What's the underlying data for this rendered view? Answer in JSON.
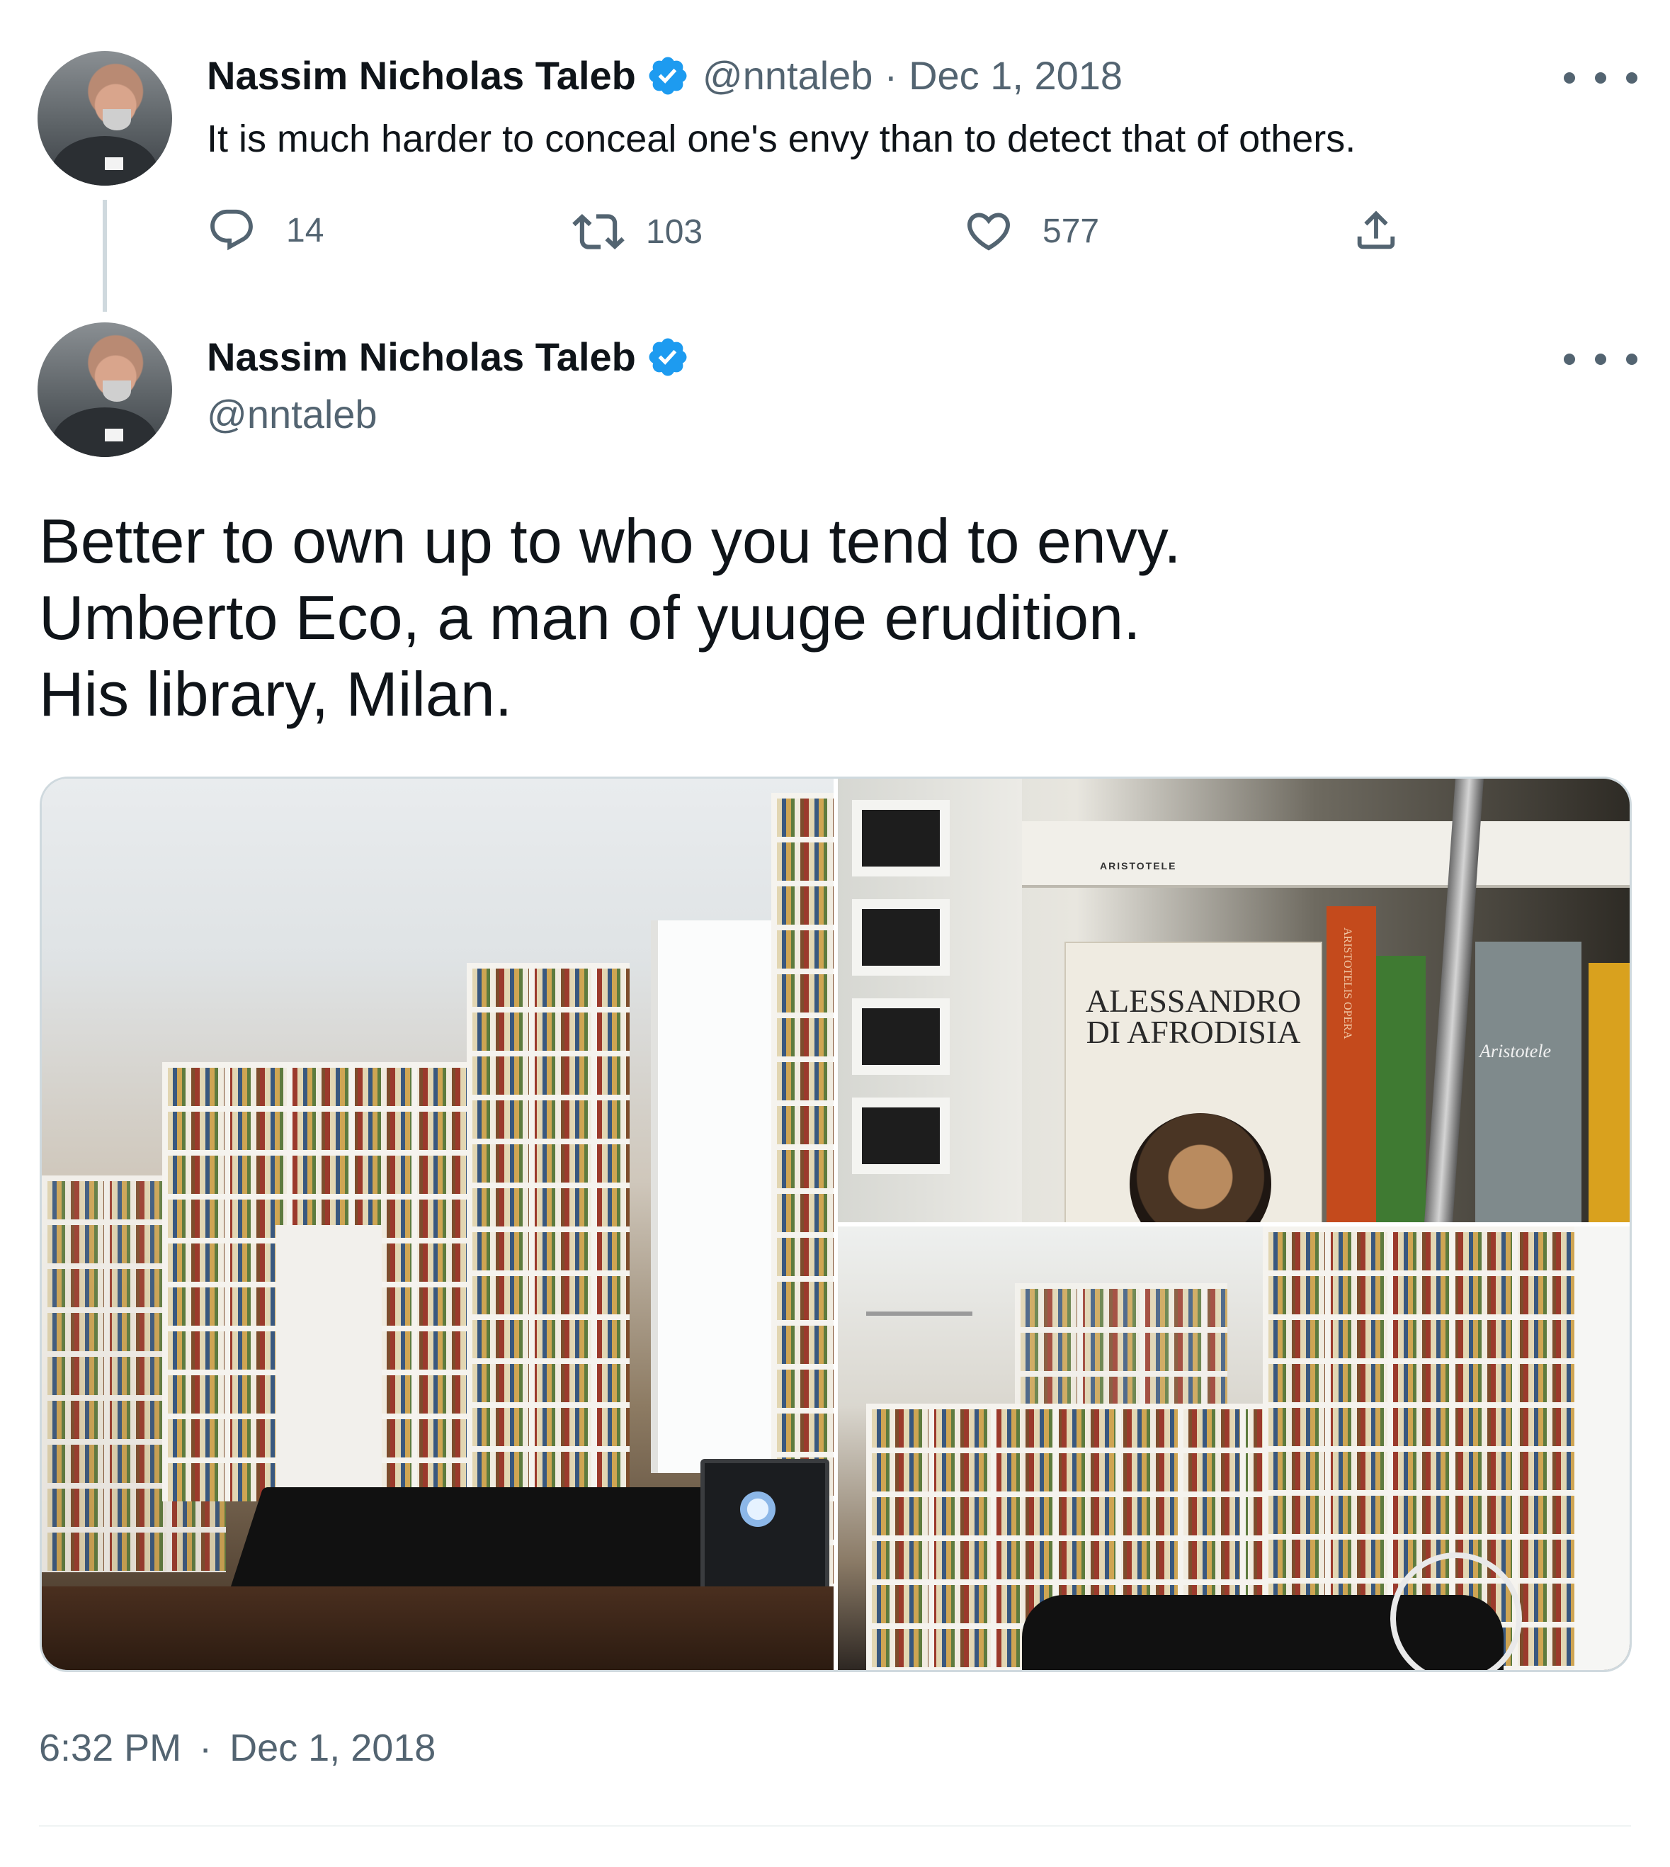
{
  "colors": {
    "verified_blue": "#1d9bf0",
    "text_primary": "#0f1419",
    "text_muted": "#536471",
    "divider": "#cfd9de"
  },
  "parent_tweet": {
    "display_name": "Nassim Nicholas Taleb",
    "handle": "@nntaleb",
    "separator": "·",
    "date": "Dec 1, 2018",
    "text": "It is much harder to conceal one's envy than to detect that of others.",
    "replies": "14",
    "retweets": "103",
    "likes": "577"
  },
  "main_tweet": {
    "display_name": "Nassim Nicholas Taleb",
    "handle": "@nntaleb",
    "lines": [
      "Better to own up to who you tend to envy.",
      "Umberto Eco, a man of yuuge erudition.",
      "His library, Milan."
    ],
    "photo_text": {
      "shelf_label": "ARISTOTELE",
      "book_title_1": "ALESSANDRO",
      "book_title_2": "DI AFRODISIA",
      "spine_text": "ARISTOTELIS OPERA",
      "side_book": "Aristotele"
    },
    "time": "6:32 PM",
    "separator": "·",
    "date": "Dec 1, 2018"
  },
  "icons": [
    "verified-badge-icon",
    "more-options-icon",
    "reply-icon",
    "retweet-icon",
    "like-icon",
    "share-icon"
  ]
}
